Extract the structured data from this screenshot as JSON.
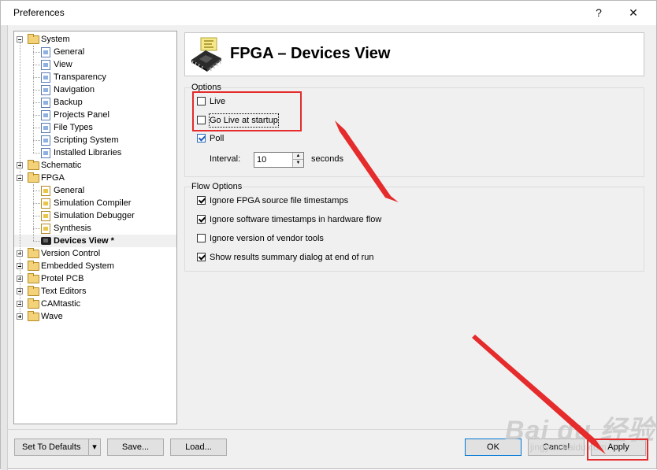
{
  "window": {
    "title": "Preferences",
    "help_glyph": "?",
    "close_glyph": "✕"
  },
  "tree": {
    "items": [
      {
        "label": "System",
        "level": 0,
        "type": "folder",
        "expanded": true
      },
      {
        "label": "General",
        "level": 1,
        "type": "page"
      },
      {
        "label": "View",
        "level": 1,
        "type": "page"
      },
      {
        "label": "Transparency",
        "level": 1,
        "type": "page"
      },
      {
        "label": "Navigation",
        "level": 1,
        "type": "page"
      },
      {
        "label": "Backup",
        "level": 1,
        "type": "page"
      },
      {
        "label": "Projects Panel",
        "level": 1,
        "type": "page"
      },
      {
        "label": "File Types",
        "level": 1,
        "type": "page"
      },
      {
        "label": "Scripting System",
        "level": 1,
        "type": "page"
      },
      {
        "label": "Installed Libraries",
        "level": 1,
        "type": "page"
      },
      {
        "label": "Schematic",
        "level": 0,
        "type": "folder",
        "expanded": false
      },
      {
        "label": "FPGA",
        "level": 0,
        "type": "folder",
        "expanded": true
      },
      {
        "label": "General",
        "level": 1,
        "type": "page-y"
      },
      {
        "label": "Simulation Compiler",
        "level": 1,
        "type": "page-y"
      },
      {
        "label": "Simulation Debugger",
        "level": 1,
        "type": "page-y"
      },
      {
        "label": "Synthesis",
        "level": 1,
        "type": "page-y"
      },
      {
        "label": "Devices View *",
        "level": 1,
        "type": "chip",
        "selected": true
      },
      {
        "label": "Version Control",
        "level": 0,
        "type": "folder",
        "expanded": false
      },
      {
        "label": "Embedded System",
        "level": 0,
        "type": "folder",
        "expanded": false
      },
      {
        "label": "Protel PCB",
        "level": 0,
        "type": "folder",
        "expanded": false
      },
      {
        "label": "Text Editors",
        "level": 0,
        "type": "folder",
        "expanded": false
      },
      {
        "label": "CAMtastic",
        "level": 0,
        "type": "folder",
        "expanded": false
      },
      {
        "label": "Wave",
        "level": 0,
        "type": "folder",
        "expanded": false
      }
    ]
  },
  "header": {
    "title": "FPGA – Devices View"
  },
  "options": {
    "group_title": "Options",
    "live_label": "Live",
    "live_checked": false,
    "golive_label": "Go Live at startup",
    "golive_checked": false,
    "poll_label": "Poll",
    "poll_checked": true,
    "interval_label": "Interval:",
    "interval_value": "10",
    "interval_unit": "seconds"
  },
  "flow_options": {
    "group_title": "Flow Options",
    "items": [
      {
        "label": "Ignore FPGA source file timestamps",
        "checked": true
      },
      {
        "label": "Ignore software timestamps in hardware flow",
        "checked": true
      },
      {
        "label": "Ignore version of vendor tools",
        "checked": false
      },
      {
        "label": "Show results summary dialog at end of run",
        "checked": true
      }
    ]
  },
  "buttons": {
    "set_defaults": "Set To Defaults",
    "dropdown_glyph": "▾",
    "save": "Save...",
    "load": "Load...",
    "ok": "OK",
    "cancel": "Cancel",
    "apply": "Apply"
  },
  "annotation_colors": {
    "highlight": "#e52b2b"
  },
  "watermark": {
    "text": "Bai du 经验",
    "sub": "jingyan.baidu.com"
  }
}
